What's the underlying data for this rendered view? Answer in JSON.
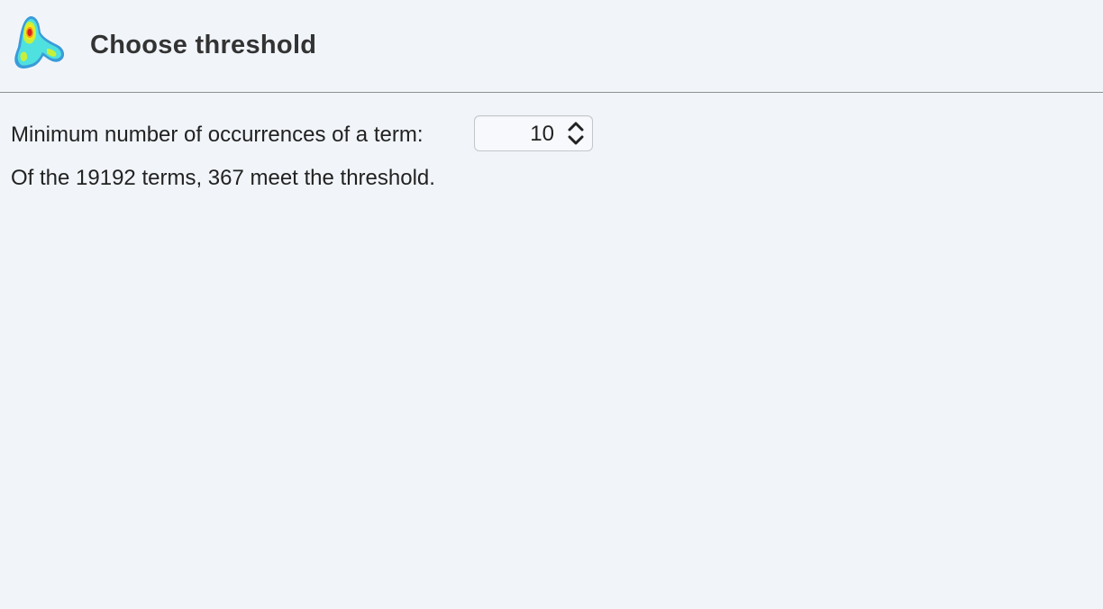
{
  "header": {
    "title": "Choose threshold",
    "logo_icon": "heatmap-logo-icon"
  },
  "form": {
    "min_occurrences_label": "Minimum number of occurrences of a term:",
    "min_occurrences_value": "10",
    "result_text": "Of the 19192 terms, 367 meet the threshold."
  },
  "colors": {
    "background": "#f1f5fa",
    "divider": "#8e8e8e"
  }
}
